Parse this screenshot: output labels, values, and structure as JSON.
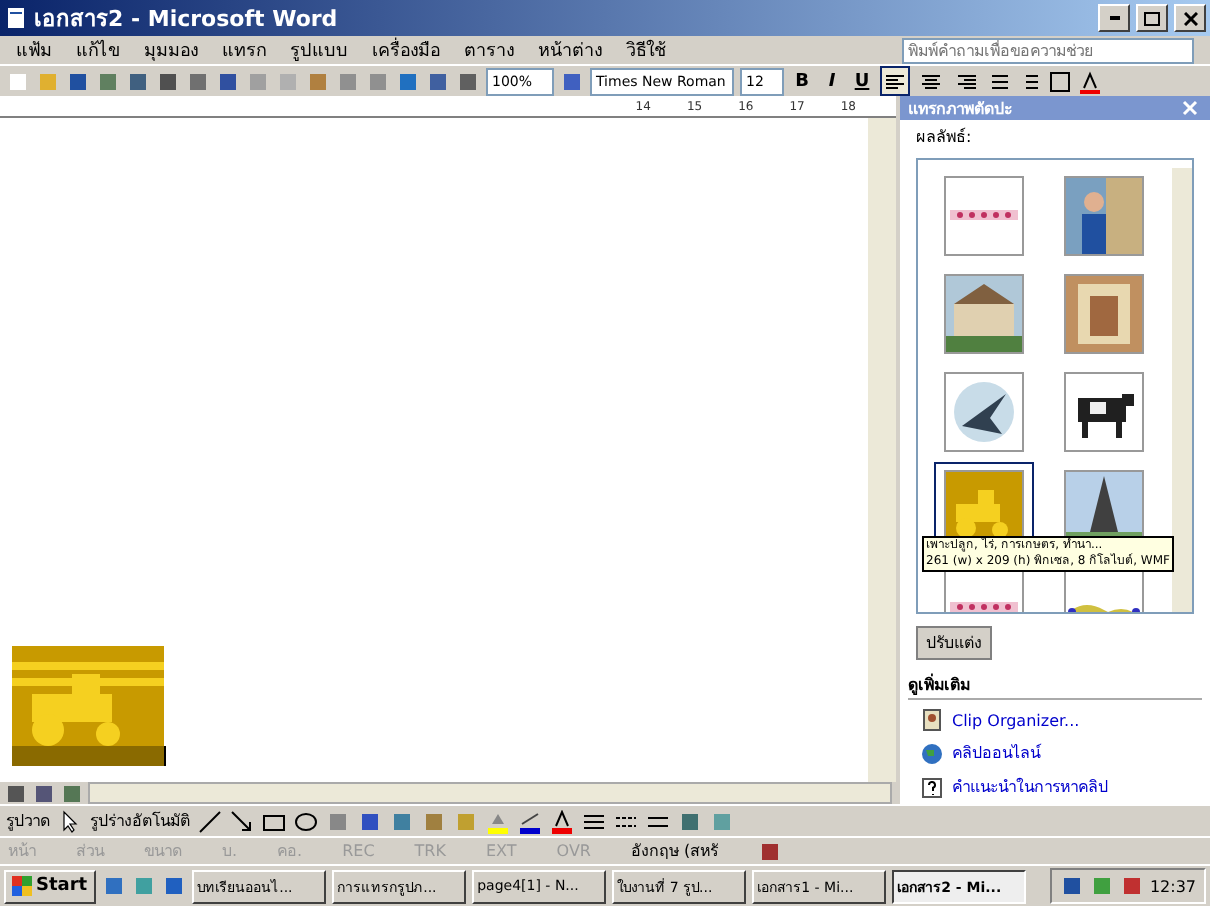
{
  "window": {
    "title": "เอกสาร2 - Microsoft Word"
  },
  "menu": [
    "แฟ้ม",
    "แก้ไข",
    "มุมมอง",
    "แทรก",
    "รูปแบบ",
    "เครื่องมือ",
    "ตาราง",
    "หน้าต่าง",
    "วิธีใช้"
  ],
  "toolbar": {
    "zoom": "100%",
    "font": "Times New Roman",
    "size": "12",
    "styles": [
      "B",
      "I",
      "U"
    ],
    "alignments": [
      {
        "selected": true
      },
      {
        "selected": false
      },
      {
        "selected": false
      }
    ]
  },
  "help_box": {
    "placeholder": "พิมพ์คำถามเพื่อขอความช่วย"
  },
  "ruler": {
    "marks": [
      "14",
      "15",
      "16",
      "17",
      "18"
    ]
  },
  "document": {
    "image": {
      "kind": "tractor"
    }
  },
  "task_pane": {
    "title": "แทรกภาพตัดปะ",
    "results_label": "ผลลัพธ์:",
    "clips": [
      {
        "kind": "stars",
        "selected": false
      },
      {
        "kind": "person",
        "selected": false
      },
      {
        "kind": "building",
        "selected": false
      },
      {
        "kind": "painting",
        "selected": false
      },
      {
        "kind": "bird",
        "selected": false
      },
      {
        "kind": "cow",
        "selected": false
      },
      {
        "kind": "tractor",
        "selected": true
      },
      {
        "kind": "tower",
        "selected": false
      },
      {
        "kind": "stars",
        "selected": false
      },
      {
        "kind": "wave",
        "selected": false
      }
    ],
    "tooltip": [
      "เพาะปลูก, ไร่, การเกษตร, ทำนา...",
      "261 (w) x 209 (h) พิกเซล, 8 กิโลไบต์, WMF"
    ],
    "modify_button": "ปรับแต่ง",
    "see_also": "ดูเพิ่มเติม",
    "links": [
      {
        "kind": "organizer",
        "label": "Clip Organizer..."
      },
      {
        "kind": "online",
        "label": "คลิปออนไลน์"
      },
      {
        "kind": "help",
        "label": "คำแนะนำในการหาคลิป"
      }
    ]
  },
  "drawing_toolbar": {
    "draw_menu": "รูปวาด",
    "autoshapes_menu": "รูปร่างอัตโนมัติ"
  },
  "status_bar": {
    "fields": [
      "หน้า",
      "ส่วน",
      "ขนาด",
      "บ.",
      "คอ."
    ],
    "modes": [
      "REC",
      "TRK",
      "EXT",
      "OVR"
    ],
    "language": "อังกฤษ (สหรั"
  },
  "taskbar": {
    "start": "Start",
    "tasks": [
      {
        "label": "บทเรียนออนไ...",
        "selected": false
      },
      {
        "label": "การแทรกรูปภ...",
        "selected": false
      },
      {
        "label": "page4[1] - N...",
        "selected": false
      },
      {
        "label": "ใบงานที่ 7 รูป...",
        "selected": false
      },
      {
        "label": "เอกสาร1 - Mi...",
        "selected": false
      },
      {
        "label": "เอกสาร2 - Mi...",
        "selected": true
      }
    ],
    "clock": "12:37"
  }
}
